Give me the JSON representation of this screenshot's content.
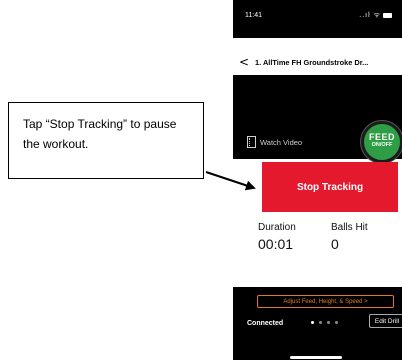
{
  "status_bar": {
    "time": "11:41",
    "icons": "..ıl ᯤ"
  },
  "nav": {
    "back_icon": "chevron-left",
    "back_glyph": "<",
    "title": "1. AllTime FH Groundstroke Dr..."
  },
  "video": {
    "watch_label": "Watch Video"
  },
  "feed_toggle": {
    "line1": "FEED",
    "line2": "ON/OFF",
    "color": "#2f9d46"
  },
  "stop_button": {
    "label": "Stop Tracking",
    "color": "#e5192d"
  },
  "stats": {
    "duration_label": "Duration",
    "duration_value": "00:01",
    "balls_label": "Balls Hit",
    "balls_value": "0"
  },
  "bottom_bar": {
    "adjust_label": "Adjust Feed, Height, & Speed >",
    "adjust_color": "#e07a1f",
    "connection_status": "Connected",
    "page_dots": 4,
    "active_dot": 1,
    "edit_label": "Edit Drill"
  },
  "annotation": {
    "text": "Tap “Stop Tracking” to pause the workout."
  }
}
